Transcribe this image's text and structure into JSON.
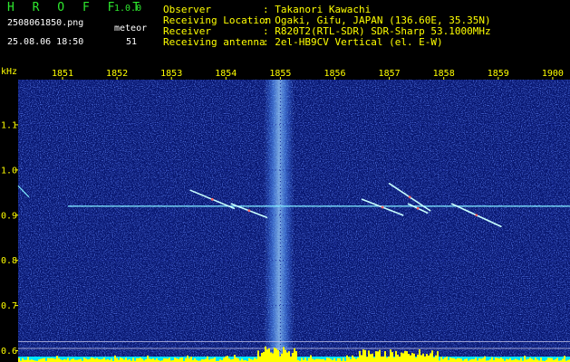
{
  "header": {
    "app_title": "H R O F F T",
    "app_version": "1.0.0",
    "filename": "2508061850.png",
    "meteor_label": "meteor",
    "datetime": "25.08.06 18:50",
    "meteor_count": "51"
  },
  "info": [
    {
      "key": "Observer",
      "value": ": Takanori Kawachi"
    },
    {
      "key": "Receiving Location",
      "value": ": Ogaki, Gifu, JAPAN (136.60E, 35.35N)"
    },
    {
      "key": "Receiver",
      "value": ": R820T2(RTL-SDR) SDR-Sharp 53.1000MHz"
    },
    {
      "key": "Receiving antenna",
      "value": ": 2el-HB9CV Vertical (el. E-W)"
    }
  ],
  "colors": {
    "background": "#000000",
    "plot_noise": "#0a1a8c",
    "header_title": "#2ee82e",
    "header_info": "#ffff00",
    "tick_labels": "#ffff00",
    "echo": "#c8ffff",
    "activity_bars": "#ffff00",
    "activity_base": "#00e5ff"
  },
  "chart_data": {
    "type": "heatmap",
    "description_unit": "kHz",
    "x_unit_label": "",
    "y_unit_label": "kHz",
    "x_ticks": [
      "1851",
      "1852",
      "1853",
      "1854",
      "1855",
      "1856",
      "1857",
      "1858",
      "1859",
      "1900"
    ],
    "x_range": [
      1850.5,
      1900.0
    ],
    "y_ticks": [
      1.1,
      1.0,
      0.9,
      0.8,
      0.7,
      0.6
    ],
    "y_tick_labels": [
      "1.1",
      "1.0",
      "0.9",
      "0.8",
      "0.7",
      "0.6"
    ],
    "y_range": [
      0.575,
      1.2
    ],
    "carrier_frequency_khz": 0.92,
    "carrier_span_minutes": [
      1851.1,
      1900.0
    ],
    "broadband_band_minutes": [
      1854.7,
      1855.25
    ],
    "meteor_echoes": [
      {
        "start_min": 1853.35,
        "end_min": 1854.15,
        "start_khz": 0.955,
        "end_khz": 0.915
      },
      {
        "start_min": 1854.1,
        "end_min": 1854.75,
        "start_khz": 0.925,
        "end_khz": 0.895
      },
      {
        "start_min": 1856.5,
        "end_min": 1857.25,
        "start_khz": 0.935,
        "end_khz": 0.9
      },
      {
        "start_min": 1857.0,
        "end_min": 1857.75,
        "start_khz": 0.97,
        "end_khz": 0.91
      },
      {
        "start_min": 1857.35,
        "end_min": 1857.7,
        "start_khz": 0.925,
        "end_khz": 0.905
      },
      {
        "start_min": 1858.15,
        "end_min": 1859.05,
        "start_khz": 0.925,
        "end_khz": 0.875
      }
    ],
    "reference_lines_khz": [
      0.62,
      0.605
    ],
    "grid": true
  }
}
